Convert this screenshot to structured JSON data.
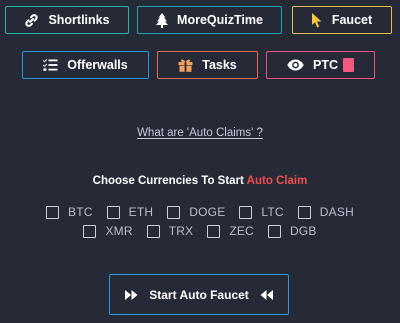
{
  "nav": {
    "shortlinks": {
      "label": "Shortlinks",
      "icon": "link-icon",
      "color": "#1fb5a8"
    },
    "morequiztime": {
      "label": "MoreQuizTime",
      "icon": "tree-icon",
      "color": "#18a9c0"
    },
    "faucet": {
      "label": "Faucet",
      "icon": "cursor-icon",
      "color": "#e0c04a"
    },
    "offerwalls": {
      "label": "Offerwalls",
      "icon": "list-check-icon",
      "color": "#2a92d8"
    },
    "tasks": {
      "label": "Tasks",
      "icon": "gift-icon",
      "color": "#e06a54"
    },
    "ptc": {
      "label": "PTC",
      "icon": "eye-icon",
      "color": "#e8577b"
    }
  },
  "auto_claim_link": "What are 'Auto Claims' ?",
  "choose_prefix": "Choose Currencies To Start ",
  "choose_accent": "Auto Claim",
  "currencies_row1": [
    "BTC",
    "ETH",
    "DOGE",
    "LTC",
    "DASH"
  ],
  "currencies_row2": [
    "XMR",
    "TRX",
    "ZEC",
    "DGB"
  ],
  "start_button": {
    "label": "Start Auto Faucet",
    "icon_left": "fast-forward-icon",
    "icon_right": "fast-backward-icon"
  },
  "colors": {
    "background": "#252a36",
    "accent_red": "#ef4d4d",
    "ptc_badge": "#f4577f"
  }
}
